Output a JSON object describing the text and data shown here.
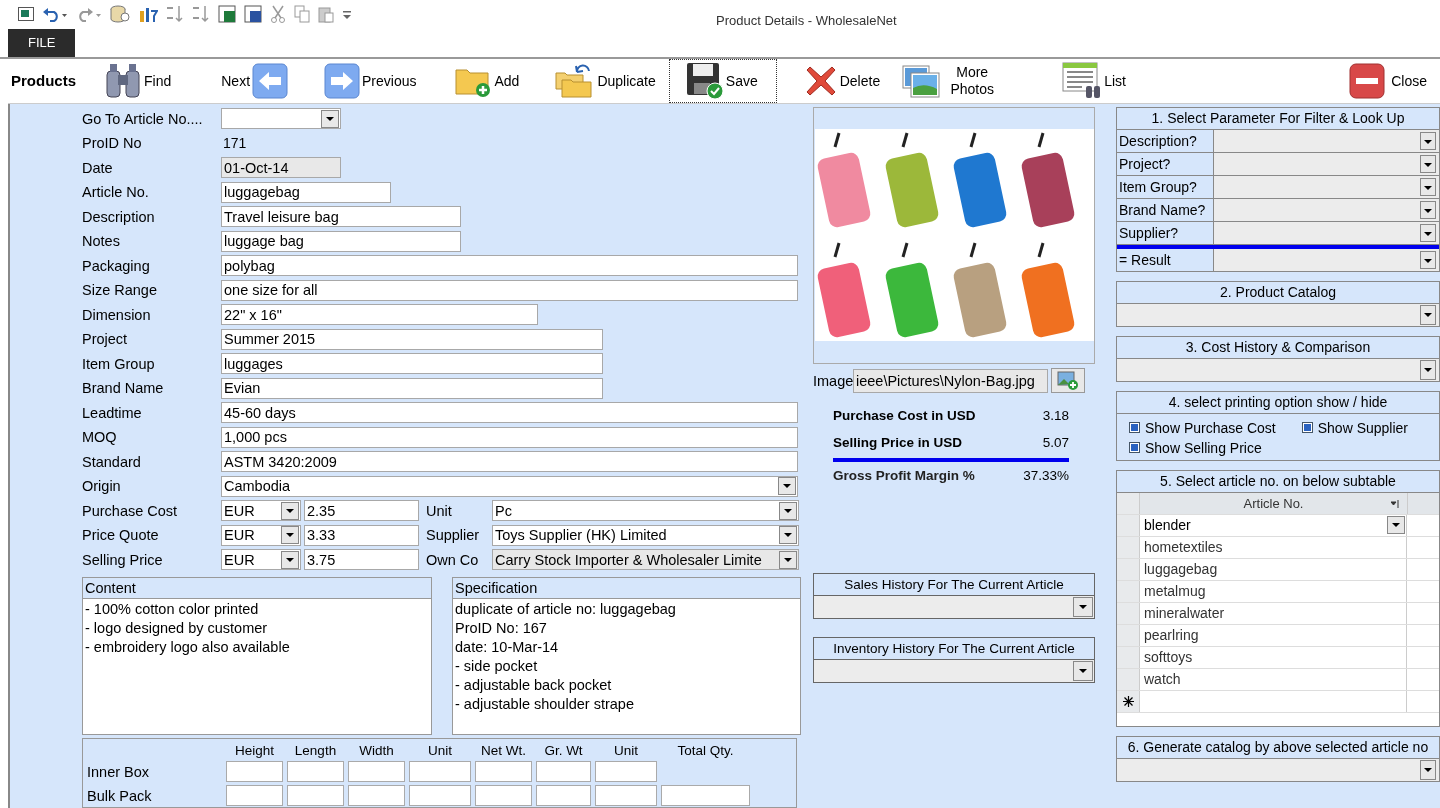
{
  "window": {
    "title": "Product Details - WholesaleNet"
  },
  "ribbon_tabs": [
    {
      "label": "FILE",
      "selected": true
    }
  ],
  "toolbar": {
    "title": "Products",
    "buttons": [
      {
        "label": "Find",
        "kind": "find",
        "focused": false
      },
      {
        "label": "Next",
        "kind": "next",
        "focused": false
      },
      {
        "label": "Previous",
        "kind": "previous",
        "focused": false
      },
      {
        "label": "Add",
        "kind": "add",
        "focused": false
      },
      {
        "label": "Duplicate",
        "kind": "duplicate",
        "focused": false
      },
      {
        "label": "Save",
        "kind": "save",
        "focused": true
      },
      {
        "label": "Delete",
        "kind": "delete",
        "focused": false
      },
      {
        "label": "More Photos",
        "kind": "photos",
        "focused": false
      },
      {
        "label": "List",
        "kind": "list",
        "focused": false
      },
      {
        "label": "Close",
        "kind": "close",
        "focused": false
      }
    ]
  },
  "form": {
    "fields": [
      {
        "label": "Go To Article No....",
        "kind": "combo"
      },
      {
        "label": "ProID No",
        "kind": "plain",
        "value": "171"
      },
      {
        "label": "Date",
        "kind": "locked",
        "value": "01-Oct-14"
      },
      {
        "label": "Article No.",
        "kind": "text",
        "value": "luggagebag"
      },
      {
        "label": "Description",
        "kind": "text",
        "value": "Travel leisure bag"
      },
      {
        "label": "Notes",
        "kind": "text",
        "value": "luggage bag"
      },
      {
        "label": "Packaging",
        "kind": "text",
        "value": "polybag"
      },
      {
        "label": "Size Range",
        "kind": "text",
        "value": "one size for all"
      },
      {
        "label": "Dimension",
        "kind": "text",
        "value": "22\" x 16\""
      },
      {
        "label": "Project",
        "kind": "text",
        "value": "Summer 2015"
      },
      {
        "label": "Item Group",
        "kind": "text",
        "value": "luggages"
      },
      {
        "label": "Brand Name",
        "kind": "text",
        "value": "Evian"
      },
      {
        "label": "Leadtime",
        "kind": "text",
        "value": "45-60 days"
      },
      {
        "label": "MOQ",
        "kind": "text",
        "value": "1,000 pcs"
      },
      {
        "label": "Standard",
        "kind": "text",
        "value": "ASTM 3420:2009"
      },
      {
        "label": "Origin",
        "kind": "combo",
        "value": "Cambodia"
      }
    ],
    "price_rows": [
      {
        "label": "Purchase Cost",
        "currency": "EUR",
        "amount": "2.35",
        "side_label": "Unit",
        "side_value": "Pc",
        "side_locked": false
      },
      {
        "label": "Price Quote",
        "currency": "EUR",
        "amount": "3.33",
        "side_label": "Supplier",
        "side_value": "Toys Supplier (HK) Limited",
        "side_locked": false
      },
      {
        "label": "Selling Price",
        "currency": "EUR",
        "amount": "3.75",
        "side_label": "Own Co",
        "side_value": "Carry Stock Importer & Wholesaler Limite",
        "side_locked": true
      }
    ]
  },
  "content": {
    "title": "Content",
    "lines": [
      "- 100% cotton color printed",
      "- logo designed by customer",
      "- embroidery logo also available"
    ]
  },
  "specification": {
    "title": "Specification",
    "lines": [
      "duplicate of article no: luggagebag",
      "ProID No: 167",
      "date: 10-Mar-14",
      "- side pocket",
      "- adjustable back pocket",
      "- adjustable shoulder strape"
    ]
  },
  "packing": {
    "columns": [
      "Height",
      "Length",
      "Width",
      "Unit",
      "Net Wt.",
      "Gr. Wt",
      "Unit",
      "Total Qty."
    ],
    "rows": [
      {
        "label": "Inner Box",
        "total_field": false
      },
      {
        "label": "Bulk Pack",
        "total_field": true
      }
    ]
  },
  "image": {
    "label": "Image",
    "path": "ieee\\Pictures\\Nylon-Bag.jpg"
  },
  "costs": [
    {
      "label": "Purchase Cost in USD",
      "value": "3.18",
      "kind": "line"
    },
    {
      "label": "Selling Price in USD",
      "value": "5.07",
      "kind": "line"
    },
    {
      "label": "Gross Profit Margin %",
      "value": "37.33%",
      "kind": "total"
    }
  ],
  "history_boxes": [
    {
      "title": "Sales History For The Current Article"
    },
    {
      "title": "Inventory History For The Current Article"
    }
  ],
  "filter": {
    "title": "1. Select Parameter For Filter & Look Up",
    "params": [
      "Description?",
      "Project?",
      "Item Group?",
      "Brand Name?",
      "Supplier?"
    ],
    "result_label": "= Result"
  },
  "catalog": {
    "title": "2. Product Catalog"
  },
  "cost_history": {
    "title": "3. Cost History & Comparison"
  },
  "print_options": {
    "title": "4. select printing option show / hide",
    "options": [
      {
        "label": "Show Purchase Cost",
        "checked": true
      },
      {
        "label": "Show Supplier",
        "checked": true
      },
      {
        "label": "Show Selling Price",
        "checked": true
      }
    ]
  },
  "article_table": {
    "title": "5. Select article no.  on below subtable",
    "column": "Article No.",
    "rows": [
      {
        "value": "blender",
        "selected": true
      },
      {
        "value": "hometextiles",
        "selected": false
      },
      {
        "value": "luggagebag",
        "selected": false
      },
      {
        "value": "metalmug",
        "selected": false
      },
      {
        "value": "mineralwater",
        "selected": false
      },
      {
        "value": "pearlring",
        "selected": false
      },
      {
        "value": "softtoys",
        "selected": false
      },
      {
        "value": "watch",
        "selected": false
      }
    ]
  },
  "generate": {
    "title": "6. Generate catalog by above selected article no"
  }
}
